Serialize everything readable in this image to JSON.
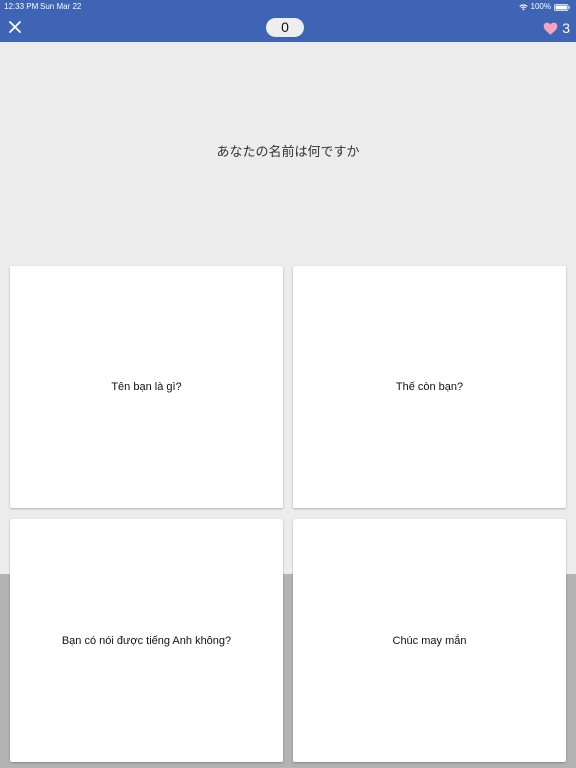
{
  "status_bar": {
    "time": "12:33 PM",
    "date": "Sun Mar 22",
    "battery": "100%"
  },
  "header": {
    "close_icon": "close-icon",
    "score": "0",
    "lives": "3",
    "heart_icon": "heart-icon"
  },
  "question": {
    "text": "あなたの名前は何ですか"
  },
  "answers": [
    {
      "label": "Tên bạn là gì?"
    },
    {
      "label": "Thế còn bạn?"
    },
    {
      "label": "Bạn có nói được tiếng Anh không?"
    },
    {
      "label": "Chúc may mắn"
    }
  ],
  "colors": {
    "header_bg": "#3f63b5",
    "page_bg": "#ececec",
    "heart": "#f4a4bd",
    "score_pill": "#eeeeee"
  }
}
